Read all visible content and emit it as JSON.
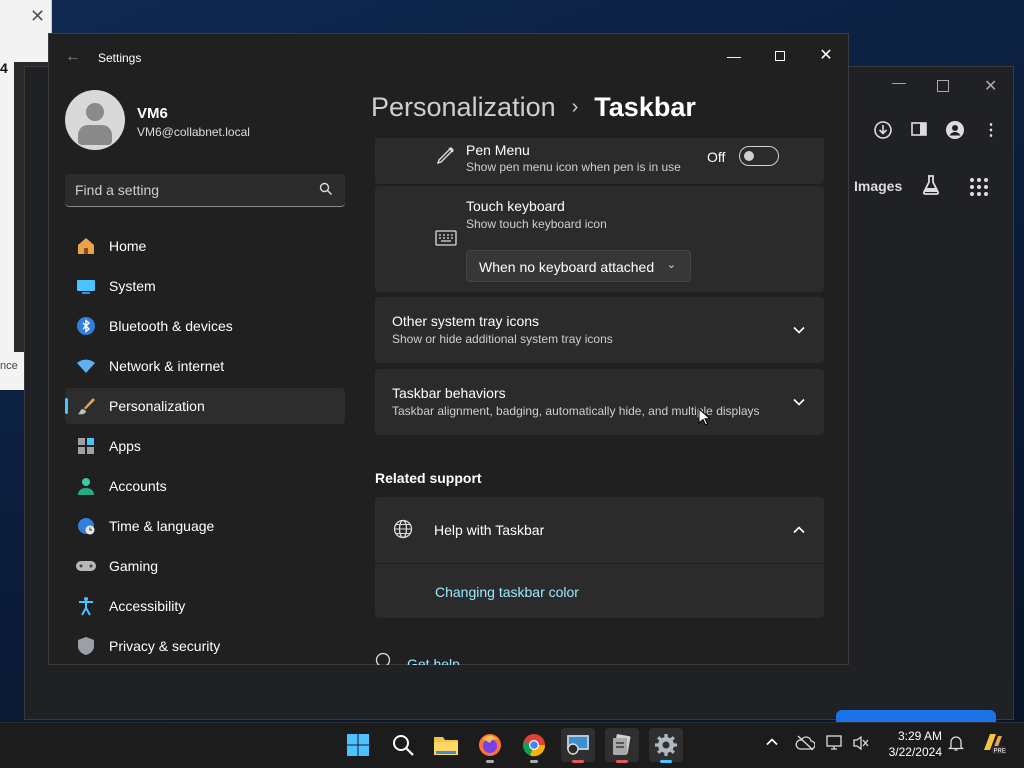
{
  "settings": {
    "window_title": "Settings",
    "user": {
      "name": "VM6",
      "email": "VM6@collabnet.local"
    },
    "search_placeholder": "Find a setting",
    "nav": [
      {
        "label": "Home",
        "icon": "home-icon",
        "selected": false
      },
      {
        "label": "System",
        "icon": "system-icon",
        "selected": false
      },
      {
        "label": "Bluetooth & devices",
        "icon": "bluetooth-icon",
        "selected": false
      },
      {
        "label": "Network & internet",
        "icon": "wifi-icon",
        "selected": false
      },
      {
        "label": "Personalization",
        "icon": "brush-icon",
        "selected": true
      },
      {
        "label": "Apps",
        "icon": "apps-icon",
        "selected": false
      },
      {
        "label": "Accounts",
        "icon": "accounts-icon",
        "selected": false
      },
      {
        "label": "Time & language",
        "icon": "globe-clock-icon",
        "selected": false
      },
      {
        "label": "Gaming",
        "icon": "gamepad-icon",
        "selected": false
      },
      {
        "label": "Accessibility",
        "icon": "accessibility-icon",
        "selected": false
      },
      {
        "label": "Privacy & security",
        "icon": "shield-icon",
        "selected": false
      }
    ],
    "breadcrumb": {
      "parent": "Personalization",
      "separator": "›",
      "current": "Taskbar"
    },
    "pen_menu": {
      "title": "Pen Menu",
      "desc": "Show pen menu icon when pen is in use",
      "state": "Off"
    },
    "touch_keyboard": {
      "title": "Touch keyboard",
      "desc": "Show touch keyboard icon",
      "dropdown": "When no keyboard attached"
    },
    "other_tray": {
      "title": "Other system tray icons",
      "desc": "Show or hide additional system tray icons"
    },
    "behaviors": {
      "title": "Taskbar behaviors",
      "desc": "Taskbar alignment, badging, automatically hide, and multiple displays"
    },
    "related_support": "Related support",
    "help": {
      "title": "Help with Taskbar",
      "link": "Changing taskbar color"
    },
    "get_help": "Get help"
  },
  "browser": {
    "images_label": "Images"
  },
  "background_window": {
    "text": "4",
    "bottom_text": "nce"
  },
  "taskbar": {
    "time": "3:29 AM",
    "date": "3/22/2024",
    "apps": [
      "windows-start-icon",
      "search-icon",
      "file-explorer-icon",
      "firefox-icon",
      "chrome-icon",
      "remote-desktop-icon",
      "app-icon",
      "settings-gear-icon"
    ]
  },
  "colors": {
    "accent": "#4cc2ff",
    "link": "#99ebff",
    "window_bg": "#202020",
    "card_bg": "#2b2b2b"
  }
}
